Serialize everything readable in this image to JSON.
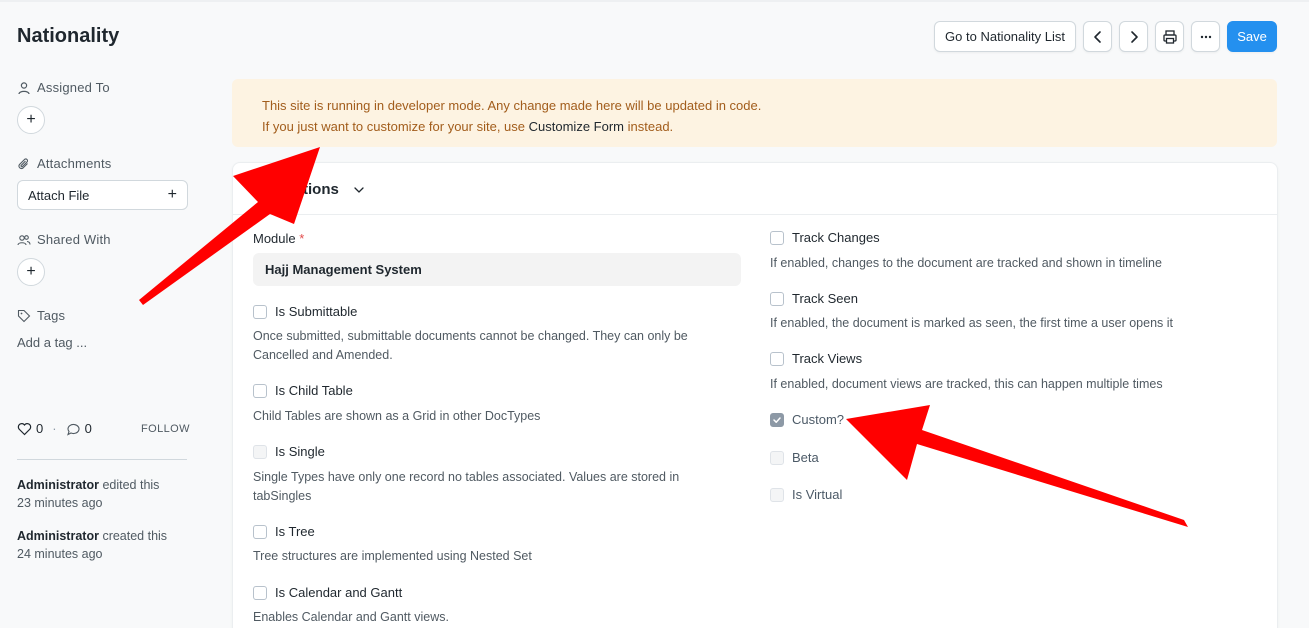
{
  "page": {
    "title": "Nationality"
  },
  "toolbar": {
    "list_label": "Go to Nationality List",
    "prev_icon": "chevron-left-icon",
    "next_icon": "chevron-right-icon",
    "print_icon": "printer-icon",
    "more_icon": "more-horizontal-icon",
    "save_label": "Save",
    "primary_color": "#2490ef"
  },
  "sidebar": {
    "assigned_to": "Assigned To",
    "attachments": "Attachments",
    "attach_file": "Attach File",
    "shared_with": "Shared With",
    "tags": "Tags",
    "add_tag": "Add a tag ...",
    "likes": "0",
    "comments": "0",
    "follow": "FOLLOW",
    "activity": [
      {
        "user": "Administrator",
        "action": "edited this",
        "time": "23 minutes ago"
      },
      {
        "user": "Administrator",
        "action": "created this",
        "time": "24 minutes ago"
      }
    ]
  },
  "banner": {
    "line1": "This site is running in developer mode. Any change made here will be updated in code.",
    "line2_prefix": "If you just want to customize for your site, use",
    "link": "Customize Form",
    "line2_suffix": "instead.",
    "bg_color": "#fdf3e2"
  },
  "form": {
    "section_title": "tions",
    "module_label": "Module",
    "required_mark": "*",
    "module_value": "Hajj Management System",
    "left_fields": [
      {
        "label": "Is Submittable",
        "checked": false,
        "disabled": false,
        "desc": "Once submitted, submittable documents cannot be changed. They can only be",
        "desc2": "Cancelled and Amended."
      },
      {
        "label": "Is Child Table",
        "checked": false,
        "disabled": false,
        "desc": "Child Tables are shown as a Grid in other DocTypes"
      },
      {
        "label": "Is Single",
        "checked": false,
        "disabled": true,
        "desc": "Single Types have only one record no tables associated. Values are stored in",
        "desc2": "tabSingles"
      },
      {
        "label": "Is Tree",
        "checked": false,
        "disabled": false,
        "desc": "Tree structures are implemented using Nested Set"
      },
      {
        "label": "Is Calendar and Gantt",
        "checked": false,
        "disabled": false,
        "desc": "Enables Calendar and Gantt views."
      }
    ],
    "right_fields": [
      {
        "label": "Track Changes",
        "checked": false,
        "disabled": false,
        "desc": "If enabled, changes to the document are tracked and shown in timeline"
      },
      {
        "label": "Track Seen",
        "checked": false,
        "disabled": false,
        "desc": "If enabled, the document is marked as seen, the first time a user opens it"
      },
      {
        "label": "Track Views",
        "checked": false,
        "disabled": false,
        "desc": "If enabled, document views are tracked, this can happen multiple times"
      },
      {
        "label": "Custom?",
        "checked": true,
        "disabled": true
      },
      {
        "label": "Beta",
        "checked": false,
        "disabled": true
      },
      {
        "label": "Is Virtual",
        "checked": false,
        "disabled": true
      }
    ]
  },
  "annotation": {
    "arrow_color": "#ff0000"
  }
}
